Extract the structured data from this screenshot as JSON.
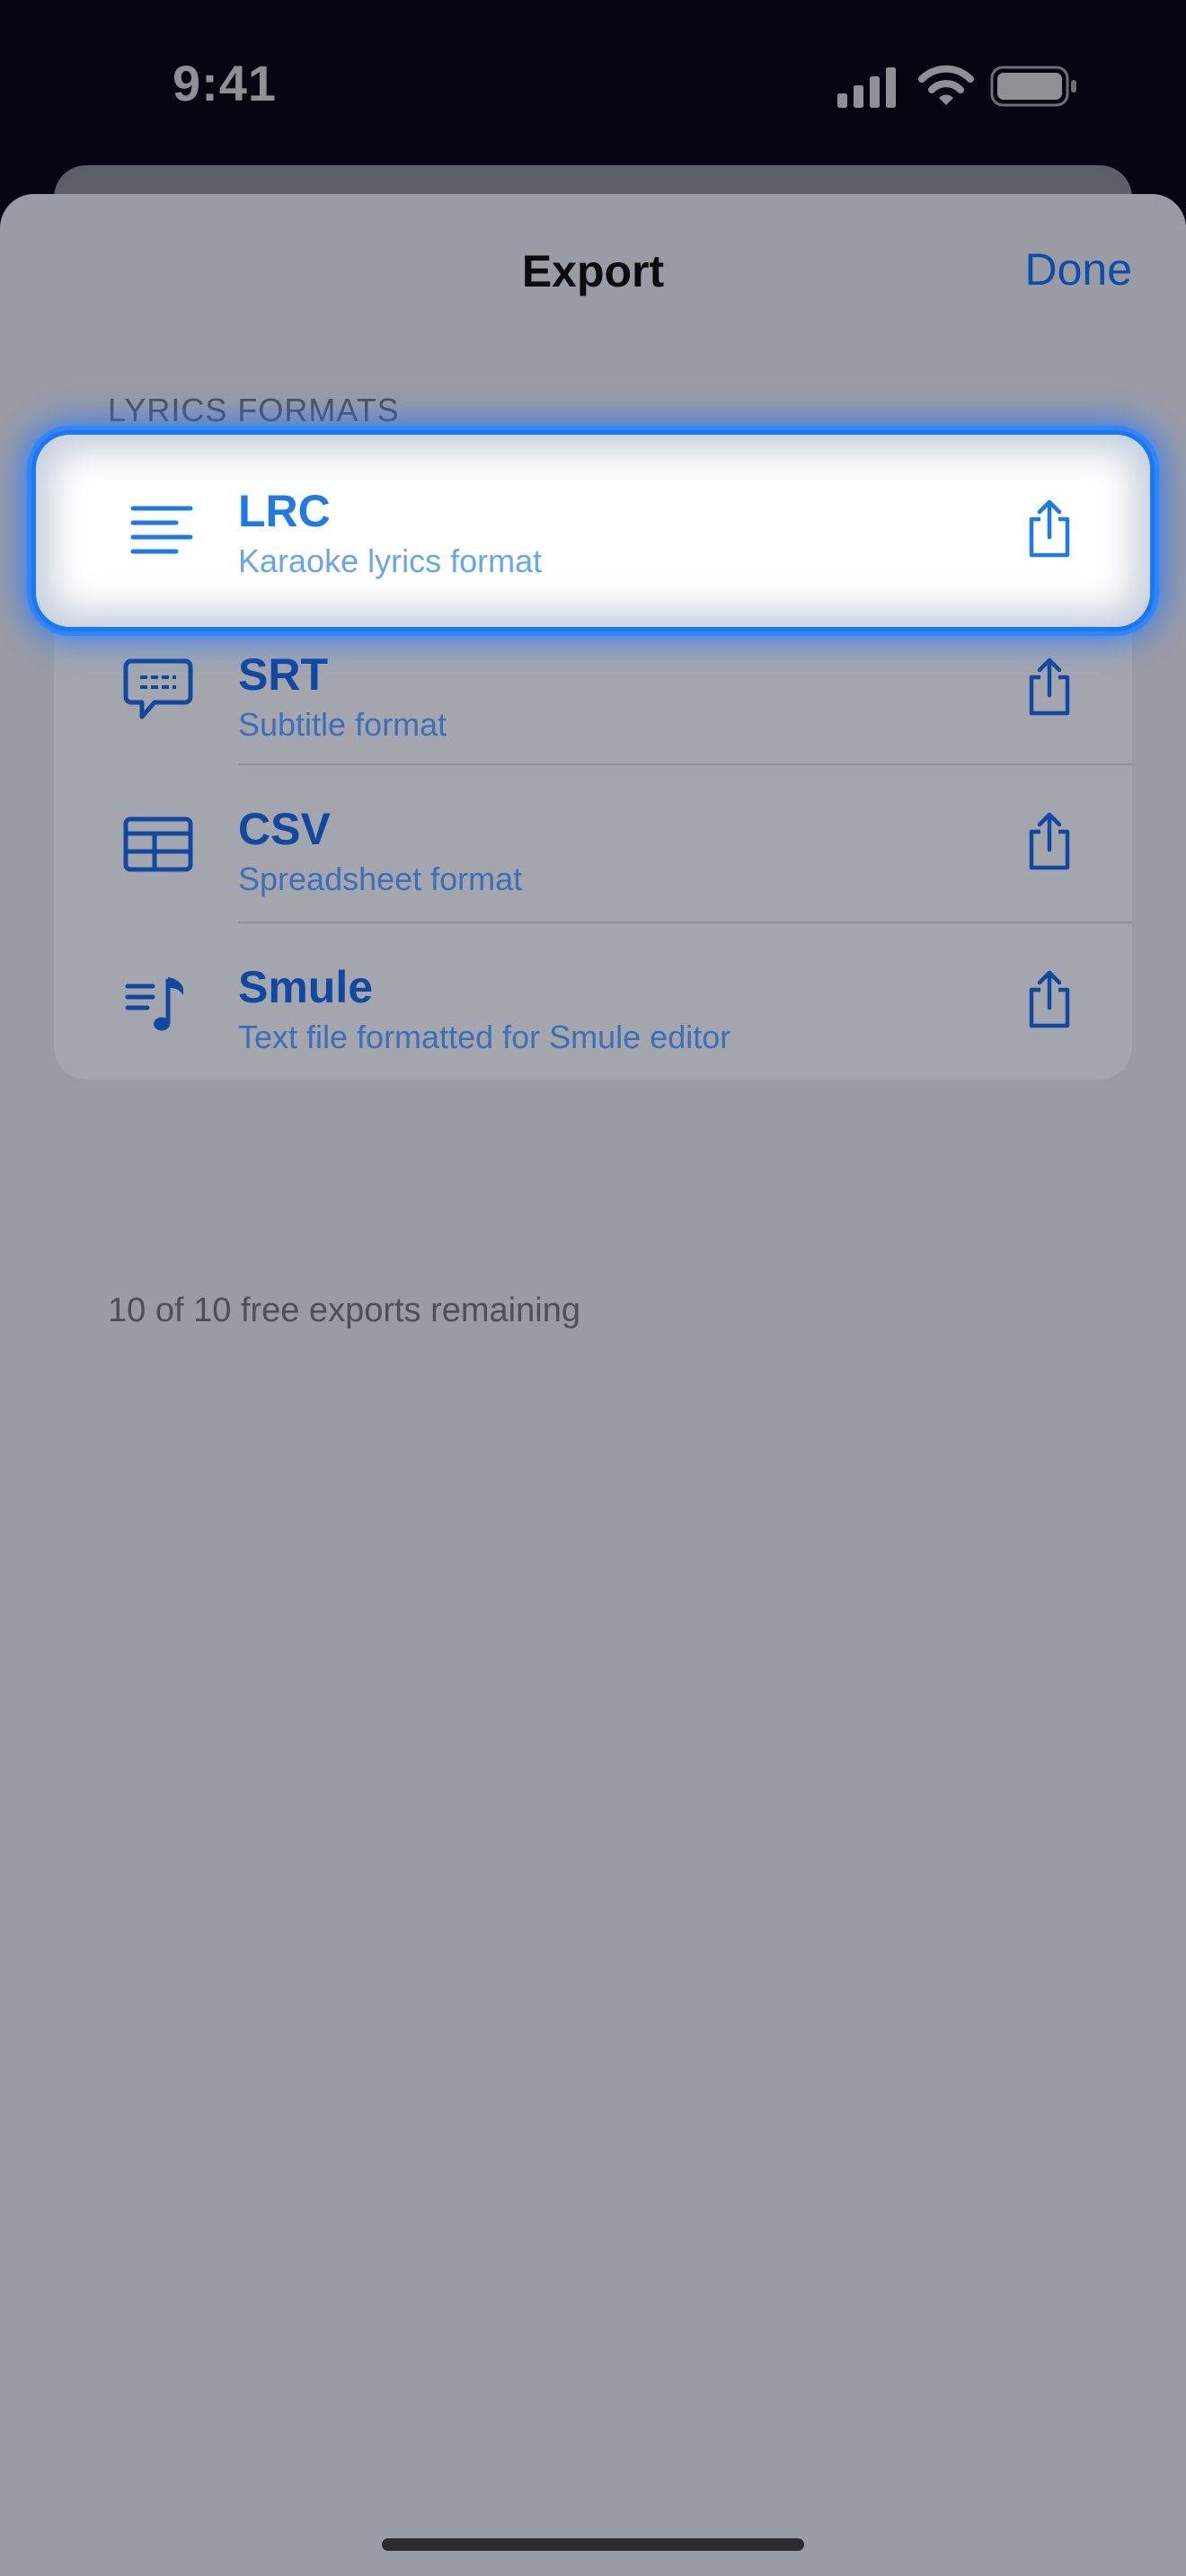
{
  "status_bar": {
    "time": "9:41"
  },
  "sheet": {
    "title": "Export",
    "done_label": "Done"
  },
  "section": {
    "header": "LYRICS FORMATS"
  },
  "formats": [
    {
      "title": "LRC",
      "subtitle": "Karaoke lyrics format",
      "icon": "text-align-left-icon"
    },
    {
      "title": "SRT",
      "subtitle": "Subtitle format",
      "icon": "speech-bubble-icon"
    },
    {
      "title": "CSV",
      "subtitle": "Spreadsheet format",
      "icon": "table-icon"
    },
    {
      "title": "Smule",
      "subtitle": "Text file formatted for Smule editor",
      "icon": "music-list-icon"
    }
  ],
  "footer": {
    "note": "10 of 10 free exports remaining"
  },
  "colors": {
    "accent": "#1149a0",
    "highlight_accent": "#1f7ae6",
    "sheet_background": "#9a9ca5",
    "group_background": "#a4a6ae"
  }
}
